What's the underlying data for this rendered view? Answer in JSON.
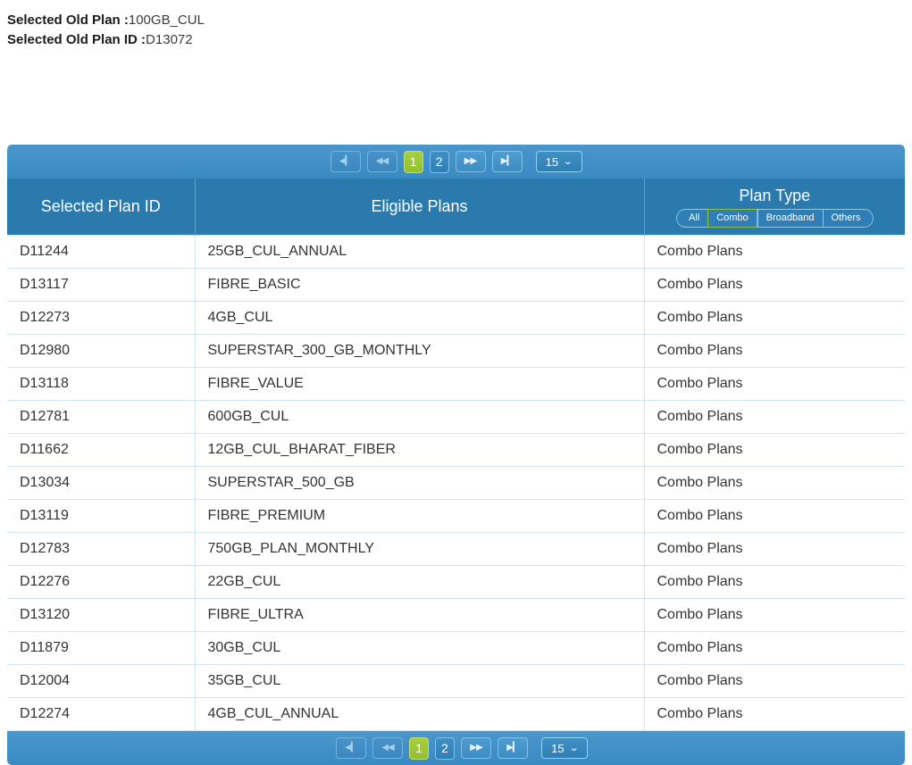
{
  "summary": {
    "plan_label": "Selected Old Plan :",
    "plan_value": "100GB_CUL",
    "plan_id_label": "Selected Old Plan ID :",
    "plan_id_value": "D13072"
  },
  "paginator": {
    "first_label": "◀▎",
    "prev_label": "◀◀",
    "next_label": "▶▶",
    "last_label": "▶▎",
    "pages": [
      {
        "label": "1",
        "active": true
      },
      {
        "label": "2",
        "active": false
      }
    ],
    "page_size": "15",
    "chevron": "⌄"
  },
  "table": {
    "columns": [
      {
        "label": "Selected Plan ID"
      },
      {
        "label": "Eligible Plans"
      },
      {
        "label": "Plan Type"
      }
    ],
    "plan_type_filters": [
      {
        "label": "All",
        "selected": false
      },
      {
        "label": "Combo",
        "selected": true
      },
      {
        "label": "Broadband",
        "selected": false
      },
      {
        "label": "Others",
        "selected": false
      }
    ],
    "rows": [
      {
        "plan_id": "D11244",
        "plan_name": "25GB_CUL_ANNUAL",
        "plan_type": "Combo Plans"
      },
      {
        "plan_id": "D13117",
        "plan_name": "FIBRE_BASIC",
        "plan_type": "Combo Plans"
      },
      {
        "plan_id": "D12273",
        "plan_name": "4GB_CUL",
        "plan_type": "Combo Plans"
      },
      {
        "plan_id": "D12980",
        "plan_name": "SUPERSTAR_300_GB_MONTHLY",
        "plan_type": "Combo Plans"
      },
      {
        "plan_id": "D13118",
        "plan_name": "FIBRE_VALUE",
        "plan_type": "Combo Plans"
      },
      {
        "plan_id": "D12781",
        "plan_name": "600GB_CUL",
        "plan_type": "Combo Plans"
      },
      {
        "plan_id": "D11662",
        "plan_name": "12GB_CUL_BHARAT_FIBER",
        "plan_type": "Combo Plans"
      },
      {
        "plan_id": "D13034",
        "plan_name": "SUPERSTAR_500_GB",
        "plan_type": "Combo Plans"
      },
      {
        "plan_id": "D13119",
        "plan_name": "FIBRE_PREMIUM",
        "plan_type": "Combo Plans"
      },
      {
        "plan_id": "D12783",
        "plan_name": "750GB_PLAN_MONTHLY",
        "plan_type": "Combo Plans"
      },
      {
        "plan_id": "D12276",
        "plan_name": "22GB_CUL",
        "plan_type": "Combo Plans"
      },
      {
        "plan_id": "D13120",
        "plan_name": "FIBRE_ULTRA",
        "plan_type": "Combo Plans"
      },
      {
        "plan_id": "D11879",
        "plan_name": "30GB_CUL",
        "plan_type": "Combo Plans"
      },
      {
        "plan_id": "D12004",
        "plan_name": "35GB_CUL",
        "plan_type": "Combo Plans"
      },
      {
        "plan_id": "D12274",
        "plan_name": "4GB_CUL_ANNUAL",
        "plan_type": "Combo Plans"
      }
    ]
  },
  "colors": {
    "toolbar_blue": "#3a8ac4",
    "header_blue": "#2a7aad",
    "active_page_green": "#a8cf3f",
    "row_border": "#cfe3f2"
  }
}
